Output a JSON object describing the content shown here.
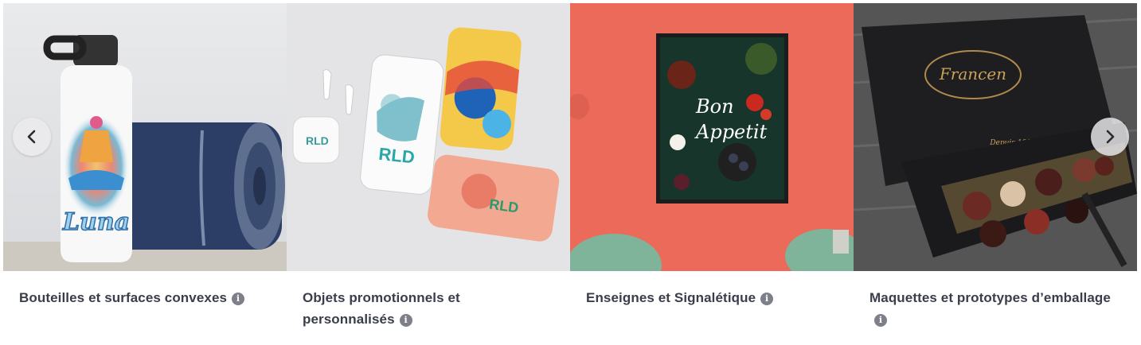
{
  "carousel": {
    "slides": [
      {
        "caption": "Bouteilles et surfaces convexes",
        "image_icon": "water-bottle-yoga-mat",
        "bottle_text": "Luna"
      },
      {
        "caption": "Objets promotionnels et personnalisés",
        "image_icon": "phone-cases-earbuds",
        "brand_text": "RLD"
      },
      {
        "caption": "Enseignes et Signalétique",
        "image_icon": "framed-poster-on-coral-wall",
        "poster_text_1": "Bon",
        "poster_text_2": "Appetit"
      },
      {
        "caption": "Maquettes et prototypes d’emballage",
        "image_icon": "chocolate-gift-box",
        "brand_text": "Francen",
        "tagline": "Depuis 1999"
      }
    ],
    "info_symbol": "i",
    "prev_icon": "chevron-left-icon",
    "next_icon": "chevron-right-icon"
  },
  "colors": {
    "caption_text": "#3a3d4a",
    "info_icon": "#7d8089",
    "coral_wall": "#ec6a5a"
  }
}
